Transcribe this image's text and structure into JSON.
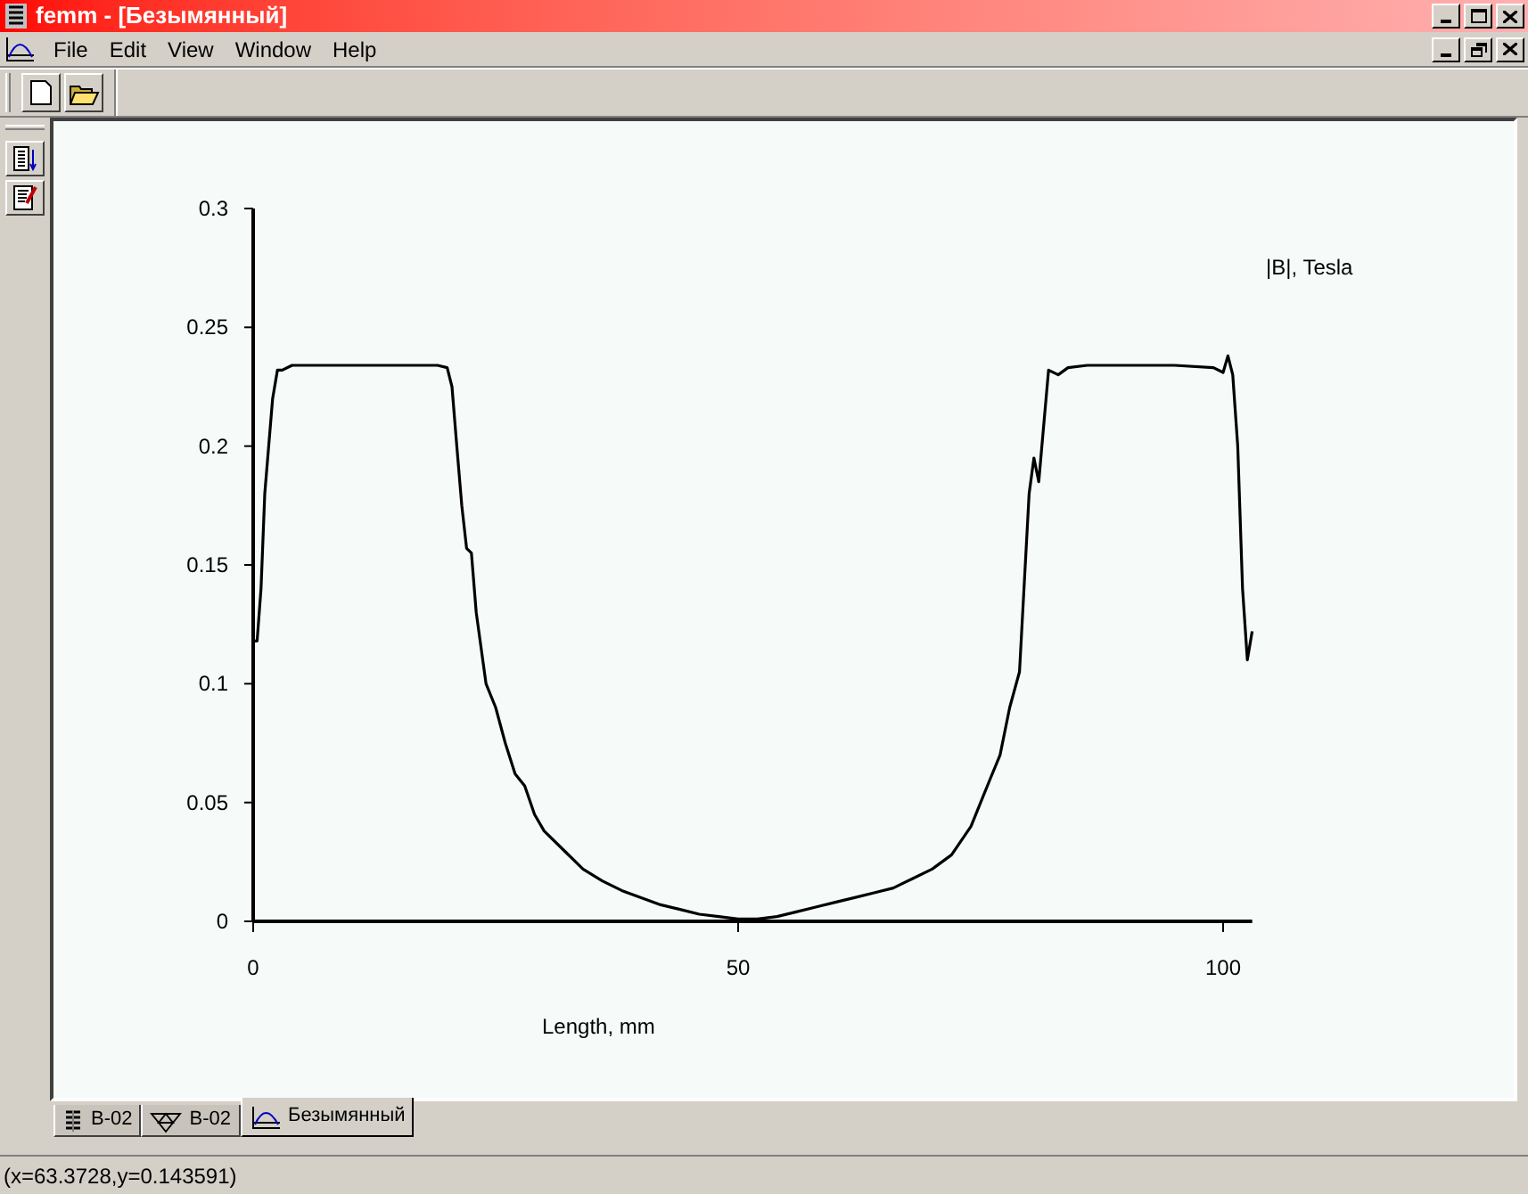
{
  "window": {
    "title": "femm - [Безымянный]"
  },
  "menu": [
    "File",
    "Edit",
    "View",
    "Window",
    "Help"
  ],
  "document": {
    "chart_data": {
      "type": "line",
      "xlabel": "Length, mm",
      "xlim": [
        0,
        103
      ],
      "ylim": [
        0,
        0.3
      ],
      "xticks": [
        0,
        50,
        100
      ],
      "yticks": [
        0,
        0.05,
        0.1,
        0.15,
        0.2,
        0.25,
        0.3
      ],
      "x": [
        0,
        0.4,
        0.8,
        1.2,
        1.6,
        2,
        2.5,
        3,
        4,
        6,
        10,
        15,
        19,
        20,
        20.5,
        21,
        21.5,
        22,
        22.5,
        23,
        24,
        25,
        26,
        27,
        28,
        29,
        30,
        32,
        34,
        36,
        38,
        40,
        42,
        44,
        46,
        48,
        50,
        52,
        54,
        56,
        58,
        60,
        62,
        64,
        66,
        68,
        70,
        72,
        74,
        75,
        76,
        77,
        78,
        79,
        80,
        80.5,
        81,
        82,
        83,
        84,
        86,
        90,
        95,
        99,
        100,
        100.5,
        101,
        101.5,
        102,
        102.5,
        103
      ],
      "series": [
        {
          "name": "|B|, Tesla",
          "color": "#000000",
          "values": [
            0.118,
            0.118,
            0.14,
            0.18,
            0.2,
            0.22,
            0.232,
            0.232,
            0.234,
            0.234,
            0.234,
            0.234,
            0.234,
            0.233,
            0.225,
            0.2,
            0.175,
            0.157,
            0.155,
            0.13,
            0.1,
            0.09,
            0.075,
            0.062,
            0.057,
            0.045,
            0.038,
            0.03,
            0.022,
            0.017,
            0.013,
            0.01,
            0.007,
            0.005,
            0.003,
            0.002,
            0.001,
            0.001,
            0.002,
            0.004,
            0.006,
            0.008,
            0.01,
            0.012,
            0.014,
            0.018,
            0.022,
            0.028,
            0.04,
            0.05,
            0.06,
            0.07,
            0.09,
            0.105,
            0.18,
            0.195,
            0.185,
            0.232,
            0.23,
            0.233,
            0.234,
            0.234,
            0.234,
            0.233,
            0.231,
            0.238,
            0.23,
            0.2,
            0.14,
            0.11,
            0.122
          ]
        }
      ]
    }
  },
  "tabs": [
    {
      "label": "B-02",
      "kind": "coil",
      "selected": false
    },
    {
      "label": "B-02",
      "kind": "mesh",
      "selected": false
    },
    {
      "label": "Безымянный",
      "kind": "plot",
      "selected": true
    }
  ],
  "status_bar": "(x=63.3728,y=0.143591)"
}
